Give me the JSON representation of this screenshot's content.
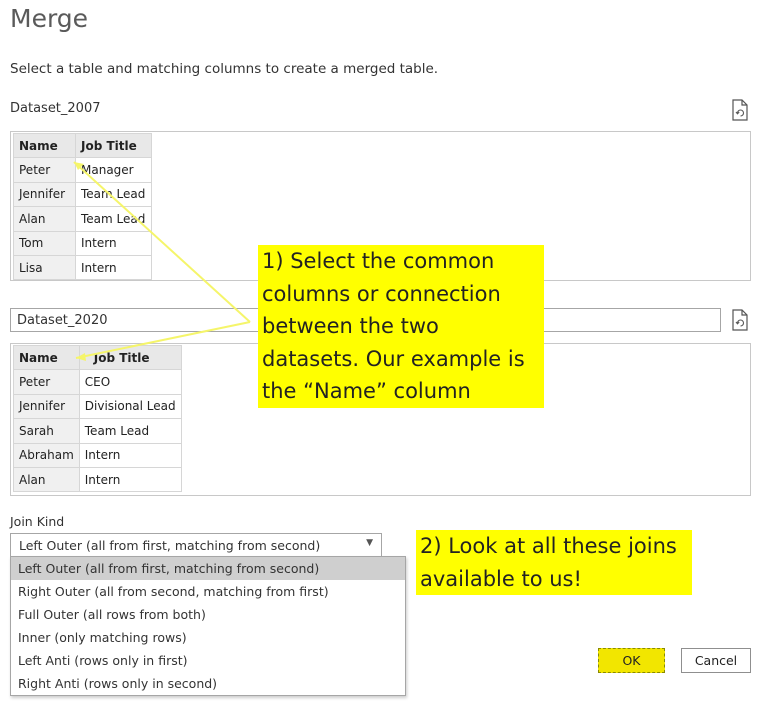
{
  "dialog": {
    "title": "Merge",
    "subtitle": "Select a table and matching columns to create a merged table."
  },
  "first_table": {
    "name": "Dataset_2007",
    "columns": [
      "Name",
      "Job Title"
    ],
    "rows": [
      [
        "Peter",
        "Manager"
      ],
      [
        "Jennifer",
        "Team Lead"
      ],
      [
        "Alan",
        "Team Lead"
      ],
      [
        "Tom",
        "Intern"
      ],
      [
        "Lisa",
        "Intern"
      ]
    ]
  },
  "second_table": {
    "selected": "Dataset_2020",
    "columns": [
      "Name",
      "Job Title"
    ],
    "rows": [
      [
        "Peter",
        "CEO"
      ],
      [
        "Jennifer",
        "Divisional Lead"
      ],
      [
        "Sarah",
        "Team Lead"
      ],
      [
        "Abraham",
        "Intern"
      ],
      [
        "Alan",
        "Intern"
      ]
    ]
  },
  "join": {
    "label": "Join Kind",
    "selected": "Left Outer (all from first, matching from second)",
    "options": [
      "Left Outer (all from first, matching from second)",
      "Right Outer (all from second, matching from first)",
      "Full Outer (all rows from both)",
      "Inner (only matching rows)",
      "Left Anti (rows only in first)",
      "Right Anti (rows only in second)"
    ]
  },
  "annotations": {
    "callout1": [
      "1) Select the common",
      "columns or connection",
      "between the two",
      "datasets. Our example is",
      "the “Name” column"
    ],
    "callout2": [
      "2) Look at all these joins",
      "available to us!"
    ],
    "highlight_color": "#ffff00",
    "arrow_color": "#f5f56a"
  },
  "buttons": {
    "ok": "OK",
    "cancel": "Cancel"
  },
  "icons": {
    "refresh": "refresh-icon"
  }
}
